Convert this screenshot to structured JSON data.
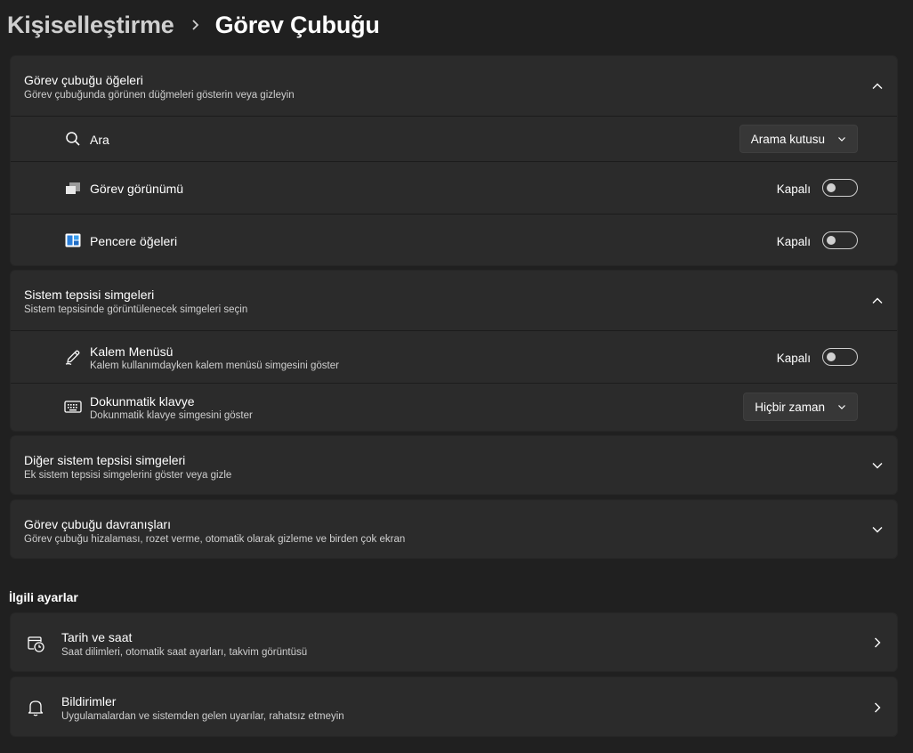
{
  "breadcrumb": {
    "parent": "Kişiselleştirme",
    "current": "Görev Çubuğu"
  },
  "taskbar_items": {
    "title": "Görev çubuğu öğeleri",
    "subtitle": "Görev çubuğunda görünen düğmeleri gösterin veya gizleyin",
    "expanded": true,
    "rows": [
      {
        "label": "Ara",
        "icon": "search-icon",
        "control": "dropdown",
        "value": "Arama kutusu"
      },
      {
        "label": "Görev görünümü",
        "icon": "task-view-icon",
        "control": "toggle",
        "state": "Kapalı",
        "on": false
      },
      {
        "label": "Pencere öğeleri",
        "icon": "widgets-icon",
        "control": "toggle",
        "state": "Kapalı",
        "on": false
      }
    ]
  },
  "system_tray": {
    "title": "Sistem tepsisi simgeleri",
    "subtitle": "Sistem tepsisinde görüntülenecek simgeleri seçin",
    "expanded": true,
    "rows": [
      {
        "label": "Kalem Menüsü",
        "description": "Kalem kullanımdayken kalem menüsü simgesini göster",
        "icon": "pen-icon",
        "control": "toggle",
        "state": "Kapalı",
        "on": false
      },
      {
        "label": "Dokunmatik klavye",
        "description": "Dokunmatik klavye simgesini göster",
        "icon": "keyboard-icon",
        "control": "dropdown",
        "value": "Hiçbir zaman"
      }
    ]
  },
  "other_tray": {
    "title": "Diğer sistem tepsisi simgeleri",
    "subtitle": "Ek sistem tepsisi simgelerini göster veya gizle",
    "expanded": false
  },
  "behaviors": {
    "title": "Görev çubuğu davranışları",
    "subtitle": "Görev çubuğu hizalaması, rozet verme, otomatik olarak gizleme ve birden çok ekran",
    "expanded": false
  },
  "related": {
    "heading": "İlgili ayarlar",
    "links": [
      {
        "title": "Tarih ve saat",
        "subtitle": "Saat dilimleri, otomatik saat ayarları, takvim görüntüsü",
        "icon": "calendar-clock-icon"
      },
      {
        "title": "Bildirimler",
        "subtitle": "Uygulamalardan ve sistemden gelen uyarılar, rahatsız etmeyin",
        "icon": "bell-icon"
      }
    ]
  },
  "colors": {
    "background": "#202020",
    "card": "#2b2b2b",
    "text": "#ffffff",
    "secondary_text": "#cfcfcf"
  }
}
